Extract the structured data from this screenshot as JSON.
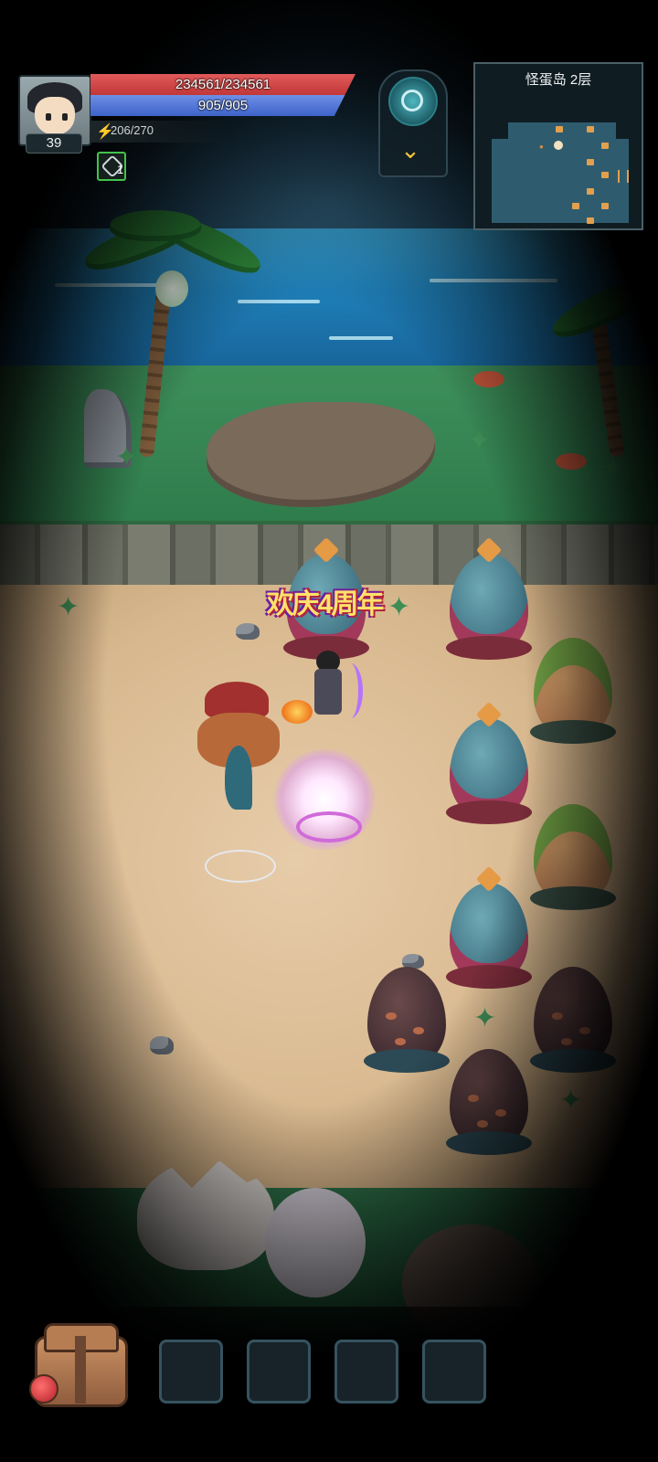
{
  "player": {
    "level": "39",
    "hp_text": "234561/234561",
    "hp_fraction": 1.0,
    "mp_text": "905/905",
    "mp_fraction": 1.0,
    "energy_text": "206/270",
    "buff_count": "1"
  },
  "minimap": {
    "title": "怪蛋岛 2层"
  },
  "event_banner": {
    "text": "欢庆4周年"
  },
  "skill": {
    "orb_icon": "portal-swirl-icon",
    "expand_icon": "chevron-down-icon"
  },
  "inventory": {
    "bag_icon": "backpack-icon",
    "slots": [
      "",
      "",
      "",
      ""
    ]
  },
  "colors": {
    "hp": "#c23737",
    "mp": "#3e63c9",
    "energy": "#e5b249",
    "minimap_room": "#2e5c6e"
  }
}
